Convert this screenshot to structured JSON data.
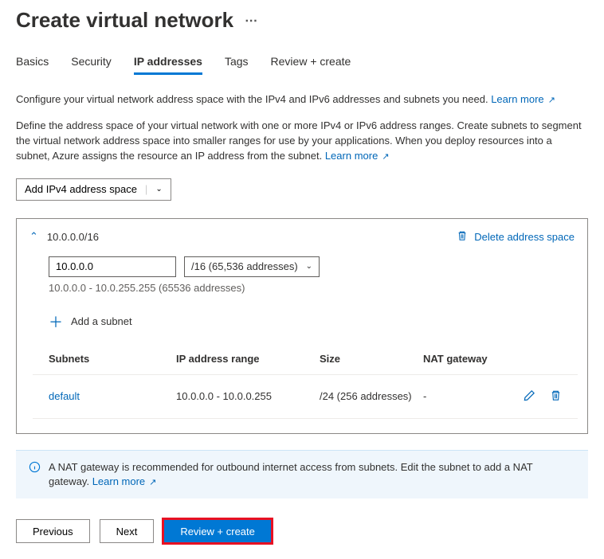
{
  "page": {
    "title": "Create virtual network"
  },
  "tabs": {
    "basics": "Basics",
    "security": "Security",
    "ip": "IP addresses",
    "tags": "Tags",
    "review": "Review + create"
  },
  "intro": {
    "text": "Configure your virtual network address space with the IPv4 and IPv6 addresses and subnets you need. ",
    "learn_more": "Learn more"
  },
  "description": {
    "text": "Define the address space of your virtual network with one or more IPv4 or IPv6 address ranges. Create subnets to segment the virtual network address space into smaller ranges for use by your applications. When you deploy resources into a subnet, Azure assigns the resource an IP address from the subnet. ",
    "learn_more": "Learn more"
  },
  "add_space_button": "Add IPv4 address space",
  "address_card": {
    "title": "10.0.0.0/16",
    "delete_label": "Delete address space",
    "ip_value": "10.0.0.0",
    "cidr_label": "/16 (65,536 addresses)",
    "range_hint": "10.0.0.0 - 10.0.255.255 (65536 addresses)",
    "add_subnet_label": "Add a subnet",
    "table": {
      "headers": {
        "subnets": "Subnets",
        "range": "IP address range",
        "size": "Size",
        "nat": "NAT gateway"
      },
      "rows": [
        {
          "name": "default",
          "range": "10.0.0.0 - 10.0.0.255",
          "size": "/24 (256 addresses)",
          "nat": "-"
        }
      ]
    }
  },
  "info": {
    "text": "A NAT gateway is recommended for outbound internet access from subnets. Edit the subnet to add a NAT gateway. ",
    "learn_more": "Learn more"
  },
  "footer": {
    "previous": "Previous",
    "next": "Next",
    "review": "Review + create"
  }
}
